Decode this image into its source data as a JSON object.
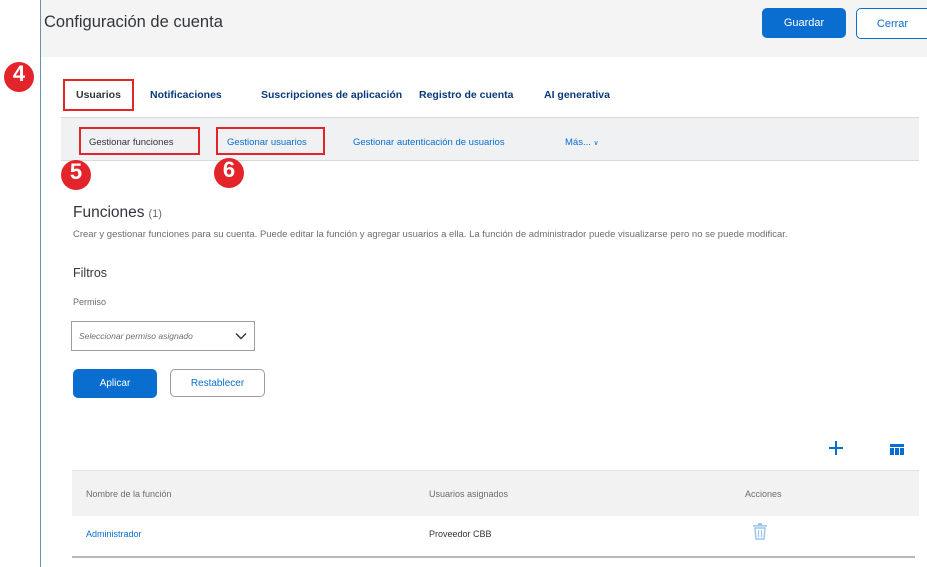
{
  "window": {
    "title": "Configuración de cuenta",
    "save_label": "Guardar",
    "close_label": "Cerrar"
  },
  "tabs": [
    {
      "label": "Usuarios",
      "active": true
    },
    {
      "label": "Notificaciones"
    },
    {
      "label": "Suscripciones de aplicación"
    },
    {
      "label": "Registro de cuenta"
    },
    {
      "label": "AI generativa"
    }
  ],
  "subtabs": [
    {
      "label": "Gestionar funciones",
      "active": true
    },
    {
      "label": "Gestionar usuarios"
    },
    {
      "label": "Gestionar autenticación de usuarios"
    },
    {
      "label": "Más..."
    }
  ],
  "annotations": [
    "4",
    "5",
    "6"
  ],
  "section": {
    "title": "Funciones",
    "count": "(1)",
    "description": "Crear y gestionar funciones para su cuenta. Puede editar la función y agregar usuarios a ella. La función de administrador puede visualizarse pero no se puede modificar."
  },
  "filters": {
    "title": "Filtros",
    "permission_label": "Permiso",
    "permission_placeholder": "Seleccionar permiso asignado",
    "apply_label": "Aplicar",
    "reset_label": "Restablecer"
  },
  "table": {
    "columns": [
      "Nombre de la función",
      "Usuarios asignados",
      "Acciones"
    ],
    "rows": [
      {
        "name": "Administrador",
        "users": "Proveedor CBB"
      }
    ]
  },
  "colors": {
    "accent": "#0a6ed1",
    "annotation": "#e3242b"
  },
  "icons": [
    "chevron-down-icon",
    "plus-icon",
    "column-settings-icon",
    "trash-icon"
  ]
}
